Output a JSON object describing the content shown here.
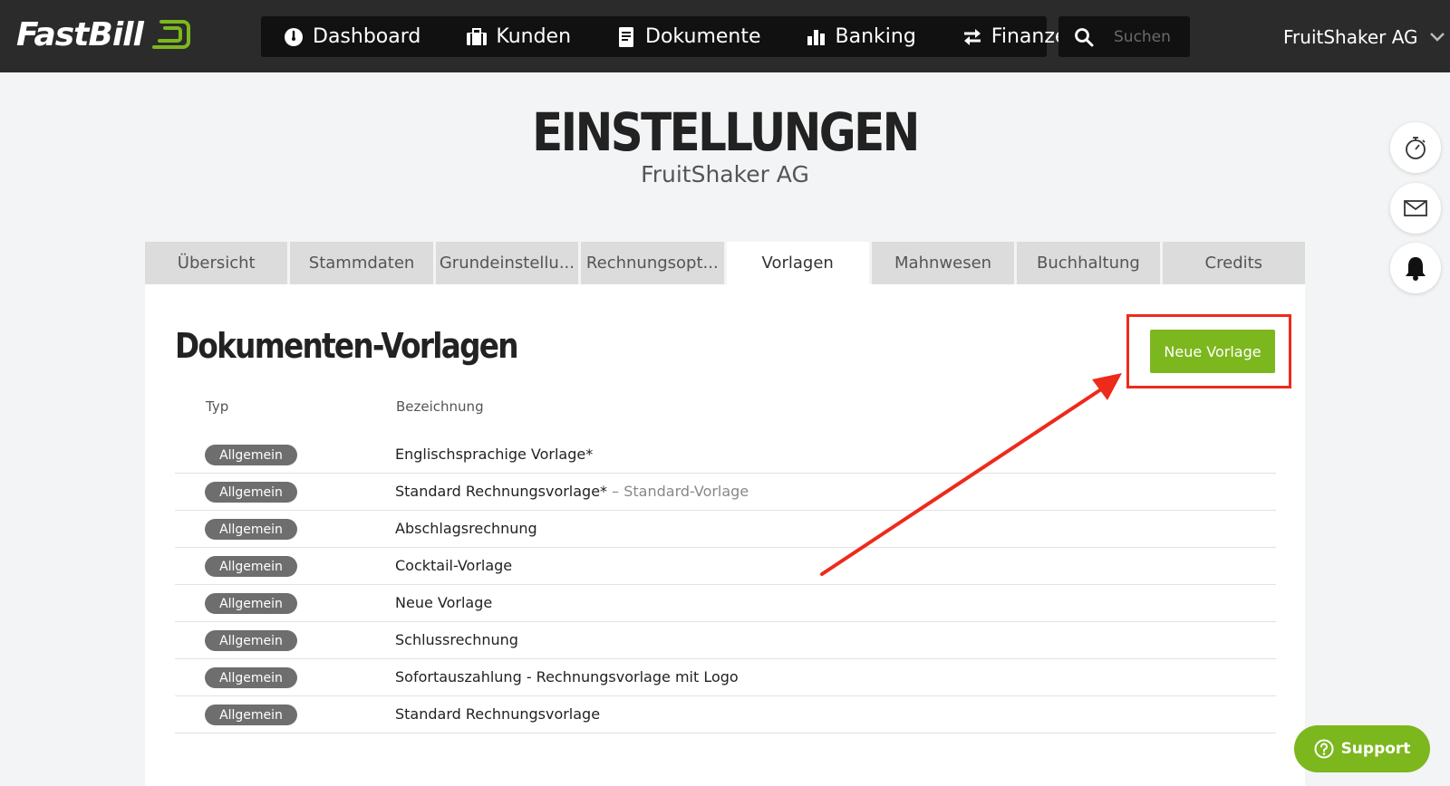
{
  "brand": {
    "logo_text": "FastBill",
    "accent": "#7cb71e"
  },
  "nav": {
    "items": [
      {
        "label": "Dashboard",
        "icon": "dashboard-gauge-icon"
      },
      {
        "label": "Kunden",
        "icon": "briefcase-icon"
      },
      {
        "label": "Dokumente",
        "icon": "document-icon"
      },
      {
        "label": "Banking",
        "icon": "bar-chart-icon"
      },
      {
        "label": "Finanzen",
        "icon": "transfer-arrows-icon"
      }
    ],
    "search_placeholder": "Suchen",
    "account_name": "FruitShaker AG"
  },
  "page": {
    "title": "EINSTELLUNGEN",
    "subtitle": "FruitShaker AG"
  },
  "tabs": [
    {
      "label": "Übersicht",
      "active": false
    },
    {
      "label": "Stammdaten",
      "active": false
    },
    {
      "label": "Grundeinstellu...",
      "active": false
    },
    {
      "label": "Rechnungsopt...",
      "active": false
    },
    {
      "label": "Vorlagen",
      "active": true
    },
    {
      "label": "Mahnwesen",
      "active": false
    },
    {
      "label": "Buchhaltung",
      "active": false
    },
    {
      "label": "Credits",
      "active": false
    }
  ],
  "templates": {
    "heading": "Dokumenten-Vorlagen",
    "new_button": "Neue Vorlage",
    "columns": {
      "type": "Typ",
      "name": "Bezeichnung"
    },
    "rows": [
      {
        "type": "Allgemein",
        "name": "Englischsprachige Vorlage*",
        "suffix": ""
      },
      {
        "type": "Allgemein",
        "name": "Standard Rechnungsvorlage*",
        "suffix": " – Standard-Vorlage"
      },
      {
        "type": "Allgemein",
        "name": "Abschlagsrechnung",
        "suffix": ""
      },
      {
        "type": "Allgemein",
        "name": "Cocktail-Vorlage",
        "suffix": ""
      },
      {
        "type": "Allgemein",
        "name": "Neue Vorlage",
        "suffix": ""
      },
      {
        "type": "Allgemein",
        "name": "Schlussrechnung",
        "suffix": ""
      },
      {
        "type": "Allgemein",
        "name": "Sofortauszahlung - Rechnungsvorlage mit Logo",
        "suffix": ""
      },
      {
        "type": "Allgemein",
        "name": "Standard Rechnungsvorlage",
        "suffix": ""
      }
    ]
  },
  "side_actions": [
    {
      "icon": "stopwatch-icon"
    },
    {
      "icon": "mail-icon"
    },
    {
      "icon": "bell-icon"
    }
  ],
  "support": {
    "label": "Support",
    "icon": "help-circle-icon"
  },
  "annotation": {
    "color": "#ee2a1b"
  }
}
